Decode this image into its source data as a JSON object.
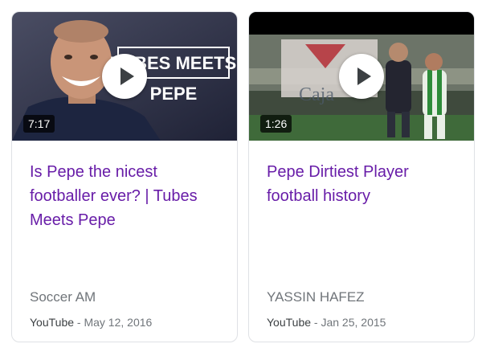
{
  "results": [
    {
      "title": "Is Pepe the nicest footballer ever? | Tubes Meets Pepe",
      "duration": "7:17",
      "channel": "Soccer AM",
      "source": "YouTube",
      "separator": " - ",
      "date": "May 12, 2016",
      "thumbnail_text_line1": "TUBES MEETS",
      "thumbnail_text_line2": "PEPE"
    },
    {
      "title": "Pepe Dirtiest Player football history",
      "duration": "1:26",
      "channel": "YASSIN HAFEZ",
      "source": "YouTube",
      "separator": " - ",
      "date": "Jan 25, 2015",
      "thumbnail_text_line1": "Caja"
    }
  ],
  "colors": {
    "title_link": "#681da8",
    "secondary_text": "#70757a",
    "card_border": "#dfe1e5"
  },
  "icons": {
    "play": "play-button-icon"
  }
}
